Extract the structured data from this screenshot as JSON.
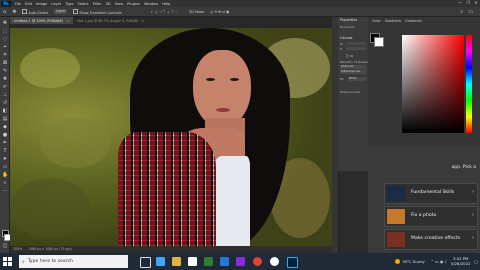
{
  "app": {
    "logo": "Ps"
  },
  "menu": [
    "File",
    "Edit",
    "Image",
    "Layer",
    "Type",
    "Select",
    "Filter",
    "3D",
    "View",
    "Plugins",
    "Window",
    "Help"
  ],
  "window_controls": [
    "—",
    "❐",
    "✕"
  ],
  "options": {
    "home": "⌂",
    "auto_select": "Auto-Select",
    "layer": "Layer",
    "show_transform": "Show Transform Controls",
    "mode_3d": "3D Mode"
  },
  "tabs": [
    {
      "label": "Untitled-1 @ 100% (RGB/8#)",
      "active": true
    },
    {
      "label": "Not-1.jpg @ 66.7% (Layer 0, RGB/8)",
      "active": false
    }
  ],
  "status": {
    "zoom": "100%",
    "doc": "1568 px x 1080 px (72 ppi)"
  },
  "properties": {
    "title": "Properties",
    "section": "Document",
    "canvas_label": "Canvas",
    "w_label": "W",
    "h_label": "H",
    "resolution": "Resolution: 72 pixels/inch",
    "mode": "RGB Color",
    "depth": "8 Bits/Channel",
    "fill_label": "Fill",
    "fill_value": "White",
    "rulers": "Rulers & Grids"
  },
  "color_panel": {
    "tabs": [
      "Color",
      "Swatches",
      "Gradients"
    ]
  },
  "learn": {
    "intro": "app. Pick a",
    "cards": [
      {
        "title": "Fundamental Skills",
        "thumb": "#1c2b45"
      },
      {
        "title": "Fix a photo",
        "thumb": "#c47a2a"
      },
      {
        "title": "Make creative effects",
        "thumb": "#7a3020"
      }
    ]
  },
  "taskbar": {
    "search_placeholder": "Type here to search",
    "weather": "35°C  Sunny",
    "time": "3:02 PM",
    "date": "5/28/2022"
  },
  "colors": {
    "accent": "#31a8ff",
    "taskbar": "#202a36",
    "panel": "#3b3b3b"
  }
}
